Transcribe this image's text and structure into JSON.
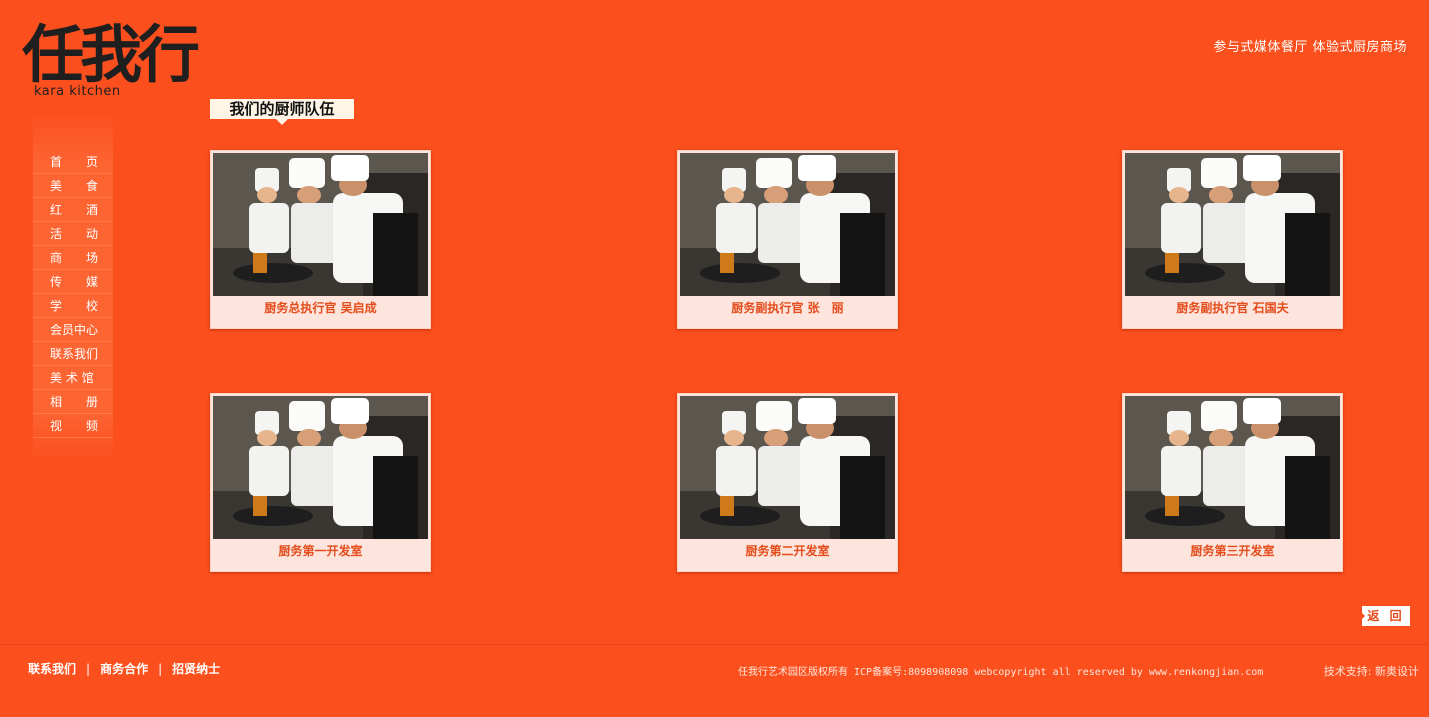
{
  "brand": {
    "logo_text": "任我行",
    "logo_subtitle": "kara kitchen"
  },
  "header": {
    "tagline": "参与式媒体餐厅  体验式厨房商场"
  },
  "section": {
    "title": "我们的厨师队伍"
  },
  "nav": {
    "items": [
      {
        "label": "首　　页"
      },
      {
        "label": "美　　食"
      },
      {
        "label": "红　　酒"
      },
      {
        "label": "活　　动"
      },
      {
        "label": "商　　场"
      },
      {
        "label": "传　　媒"
      },
      {
        "label": "学　　校"
      },
      {
        "label": "会员中心"
      },
      {
        "label": "联系我们"
      },
      {
        "label": "美 术 馆"
      },
      {
        "label": "相　　册"
      },
      {
        "label": "视　　频"
      }
    ]
  },
  "cards": [
    {
      "caption": "厨务总执行官  吴启成"
    },
    {
      "caption": "厨务副执行官  张　丽"
    },
    {
      "caption": "厨务副执行官  石国夫"
    },
    {
      "caption": "厨务第一开发室"
    },
    {
      "caption": "厨务第二开发室"
    },
    {
      "caption": "厨务第三开发室"
    }
  ],
  "back_button": {
    "label": "返 回"
  },
  "footer": {
    "links": [
      {
        "label": "联系我们"
      },
      {
        "label": "商务合作"
      },
      {
        "label": "招贤纳士"
      }
    ],
    "separator": "|",
    "copyright": "任我行艺术园区版权所有 ICP备案号:8098908098 webcopyright all reserved by www.renkongjian.com",
    "support": "技术支持: 新奥设计"
  },
  "colors": {
    "background": "#fb4f1d",
    "card_bg": "#fde4dc",
    "caption": "#e44c1c",
    "heading_bg": "#fff5e6"
  }
}
